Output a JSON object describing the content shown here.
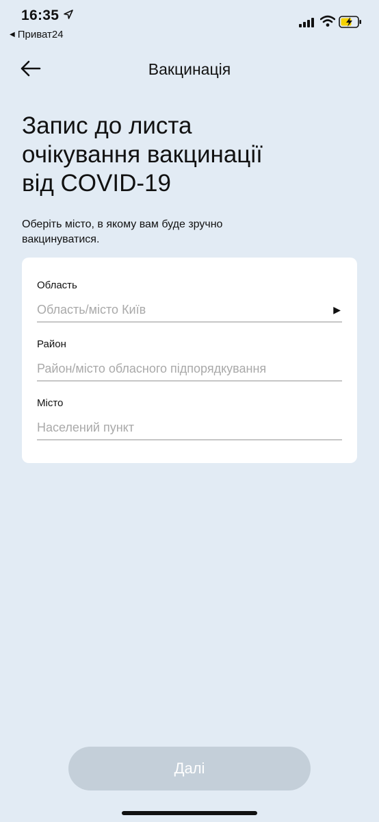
{
  "status_bar": {
    "time": "16:35",
    "back_app": "Приват24"
  },
  "header": {
    "title": "Вакцинація"
  },
  "page": {
    "title_line1": "Запис до листа",
    "title_line2": "очікування вакцинації",
    "title_line3": "від COVID-19",
    "subtitle_line1": "Оберіть місто, в якому вам буде зручно",
    "subtitle_line2": "вакцинуватися."
  },
  "form": {
    "fields": [
      {
        "label": "Область",
        "value": "Область/місто Київ",
        "has_arrow": true,
        "arrow_icon": "triangle-right-icon"
      },
      {
        "label": "Район",
        "value": "Район/місто обласного підпорядкування"
      },
      {
        "label": "Місто",
        "value": "Населений пункт"
      }
    ]
  },
  "actions": {
    "next_label": "Далі"
  },
  "colors": {
    "background": "#e2ebf4",
    "card": "#ffffff",
    "button_disabled": "#c4cfd9",
    "placeholder": "#a9a9a9",
    "battery_fill": "#f5d200"
  }
}
